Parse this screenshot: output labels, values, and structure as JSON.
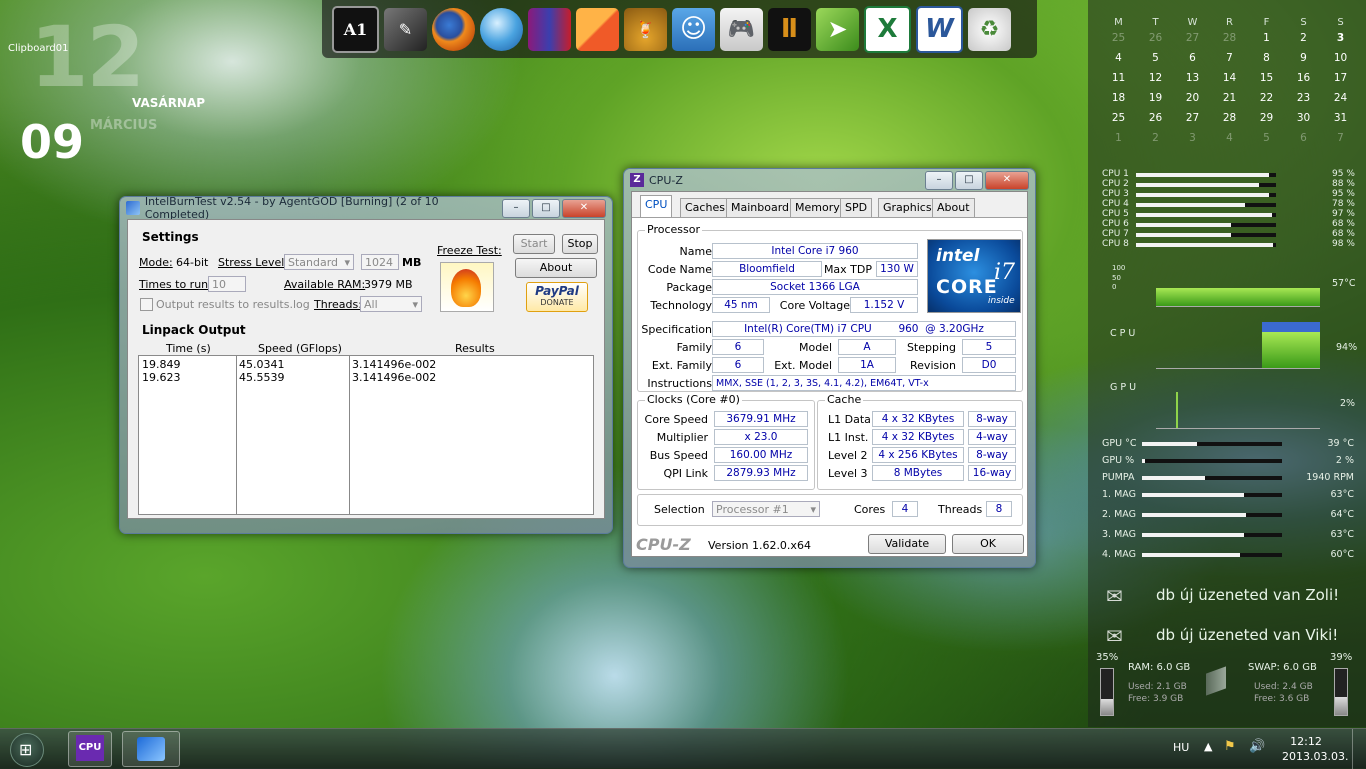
{
  "desktop": {
    "clipboard": "Clipboard01",
    "clock_hour": "12",
    "clock_minute": "09",
    "day_label": "VASÁRNAP",
    "month_label": "MÁRCIUS"
  },
  "dock": {
    "icons": [
      "A1",
      "tools",
      "firefox",
      "browser",
      "winrar",
      "blocks",
      "cocktail",
      "finder",
      "gamepad",
      "black-ops",
      "arrow",
      "excel",
      "word",
      "recycle-bin"
    ]
  },
  "ibt": {
    "title": "IntelBurnTest v2.54 - by AgentGOD [Burning] (2 of 10 Completed)",
    "settings_label": "Settings",
    "mode_label": "Mode:",
    "mode_value": "64-bit",
    "stress_label": "Stress Level:",
    "stress_value": "Standard",
    "mem_value": "1024",
    "mem_unit": "MB",
    "freeze_label": "Freeze Test:",
    "times_label": "Times to run:",
    "times_value": "10",
    "avail_ram_label": "Available RAM:",
    "avail_ram_value": "3979 MB",
    "output_check": "Output results to results.log",
    "threads_label": "Threads:",
    "threads_value": "All",
    "start_btn": "Start",
    "stop_btn": "Stop",
    "about_btn": "About",
    "paypal_btn": "PayPal",
    "donate_btn": "DONATE",
    "linpack_label": "Linpack Output",
    "col_time": "Time (s)",
    "col_speed": "Speed (GFlops)",
    "col_results": "Results",
    "rows": [
      {
        "time": "19.849",
        "speed": "45.0341",
        "result": "3.141496e-002"
      },
      {
        "time": "19.623",
        "speed": "45.5539",
        "result": "3.141496e-002"
      }
    ]
  },
  "cpuz": {
    "title": "CPU-Z",
    "tabs": [
      "CPU",
      "Caches",
      "Mainboard",
      "Memory",
      "SPD",
      "Graphics",
      "About"
    ],
    "processor_label": "Processor",
    "name_label": "Name",
    "name": "Intel Core i7 960",
    "codename_label": "Code Name",
    "codename": "Bloomfield",
    "maxtdp_label": "Max TDP",
    "maxtdp": "130 W",
    "package_label": "Package",
    "package": "Socket 1366 LGA",
    "tech_label": "Technology",
    "tech": "45 nm",
    "voltage_label": "Core Voltage",
    "voltage": "1.152 V",
    "spec_label": "Specification",
    "spec": "Intel(R) Core(TM) i7 CPU        960  @ 3.20GHz",
    "family_label": "Family",
    "family": "6",
    "model_label": "Model",
    "model": "A",
    "stepping_label": "Stepping",
    "stepping": "5",
    "extfamily_label": "Ext. Family",
    "extfamily": "6",
    "extmodel_label": "Ext. Model",
    "extmodel": "1A",
    "revision_label": "Revision",
    "revision": "D0",
    "instr_label": "Instructions",
    "instr": "MMX, SSE (1, 2, 3, 3S, 4.1, 4.2), EM64T, VT-x",
    "clocks_label": "Clocks (Core #0)",
    "corespeed_label": "Core Speed",
    "corespeed": "3679.91 MHz",
    "multiplier_label": "Multiplier",
    "multiplier": "x 23.0",
    "busspeed_label": "Bus Speed",
    "busspeed": "160.00 MHz",
    "qpi_label": "QPI Link",
    "qpi": "2879.93 MHz",
    "cache_label": "Cache",
    "l1d_label": "L1 Data",
    "l1d": "4 x 32 KBytes",
    "l1d_way": "8-way",
    "l1i_label": "L1 Inst.",
    "l1i": "4 x 32 KBytes",
    "l1i_way": "4-way",
    "l2_label": "Level 2",
    "l2": "4 x 256 KBytes",
    "l2_way": "8-way",
    "l3_label": "Level 3",
    "l3": "8 MBytes",
    "l3_way": "16-way",
    "selection_label": "Selection",
    "selection": "Processor #1",
    "cores_label": "Cores",
    "cores": "4",
    "threads_label": "Threads",
    "threads": "8",
    "logo": "CPU-Z",
    "version": "Version 1.62.0.x64",
    "validate_btn": "Validate",
    "ok_btn": "OK",
    "intel_logo": "intel",
    "intel_core": "CORE",
    "intel_i7": "i7",
    "intel_inside": "inside"
  },
  "calendar": {
    "headers": [
      "M",
      "T",
      "W",
      "R",
      "F",
      "S",
      "S"
    ],
    "weeks": [
      [
        "25",
        "26",
        "27",
        "28",
        "1",
        "2",
        "3"
      ],
      [
        "4",
        "5",
        "6",
        "7",
        "8",
        "9",
        "10"
      ],
      [
        "11",
        "12",
        "13",
        "14",
        "15",
        "16",
        "17"
      ],
      [
        "18",
        "19",
        "20",
        "21",
        "22",
        "23",
        "24"
      ],
      [
        "25",
        "26",
        "27",
        "28",
        "29",
        "30",
        "31"
      ],
      [
        "1",
        "2",
        "3",
        "4",
        "5",
        "6",
        "7"
      ]
    ]
  },
  "cpu_meters": [
    {
      "label": "CPU 1",
      "value": "95 %",
      "level": 0.95
    },
    {
      "label": "CPU 2",
      "value": "88 %",
      "level": 0.88
    },
    {
      "label": "CPU 3",
      "value": "95 %",
      "level": 0.95
    },
    {
      "label": "CPU 4",
      "value": "78 %",
      "level": 0.78
    },
    {
      "label": "CPU 5",
      "value": "97 %",
      "level": 0.97
    },
    {
      "label": "CPU 6",
      "value": "68 %",
      "level": 0.68
    },
    {
      "label": "CPU 7",
      "value": "68 %",
      "level": 0.68
    },
    {
      "label": "CPU 8",
      "value": "98 %",
      "level": 0.98
    }
  ],
  "graphs": {
    "scale_100": "100",
    "scale_50": "50",
    "scale_0": "0",
    "temp1": "57°C",
    "cpu_label": "C P U",
    "cpu_value": "94%",
    "gpu_label": "G P U",
    "gpu_value": "2%"
  },
  "sensors": [
    {
      "label": "GPU  °C",
      "value": "39 °C",
      "level": 0.39
    },
    {
      "label": "GPU  %",
      "value": "2 %",
      "level": 0.02
    },
    {
      "label": "PUMPA",
      "value": "1940 RPM",
      "level": 0.45
    },
    {
      "label": "1. MAG",
      "value": "63°C",
      "level": 0.73
    },
    {
      "label": "2. MAG",
      "value": "64°C",
      "level": 0.74
    },
    {
      "label": "3. MAG",
      "value": "63°C",
      "level": 0.73
    },
    {
      "label": "4. MAG",
      "value": "60°C",
      "level": 0.7
    }
  ],
  "messages": [
    "db új üzeneted van Zoli!",
    "db új üzeneted van Viki!"
  ],
  "memory": {
    "ram_pct": "35%",
    "ram_label": "RAM: 6.0 GB",
    "ram_used": "Used: 2.1 GB",
    "ram_free": "Free: 3.9 GB",
    "swap_pct": "39%",
    "swap_label": "SWAP: 6.0 GB",
    "swap_used": "Used: 2.4 GB",
    "swap_free": "Free: 3.6 GB"
  },
  "taskbar": {
    "lang": "HU",
    "time": "12:12",
    "date": "2013.03.03."
  }
}
